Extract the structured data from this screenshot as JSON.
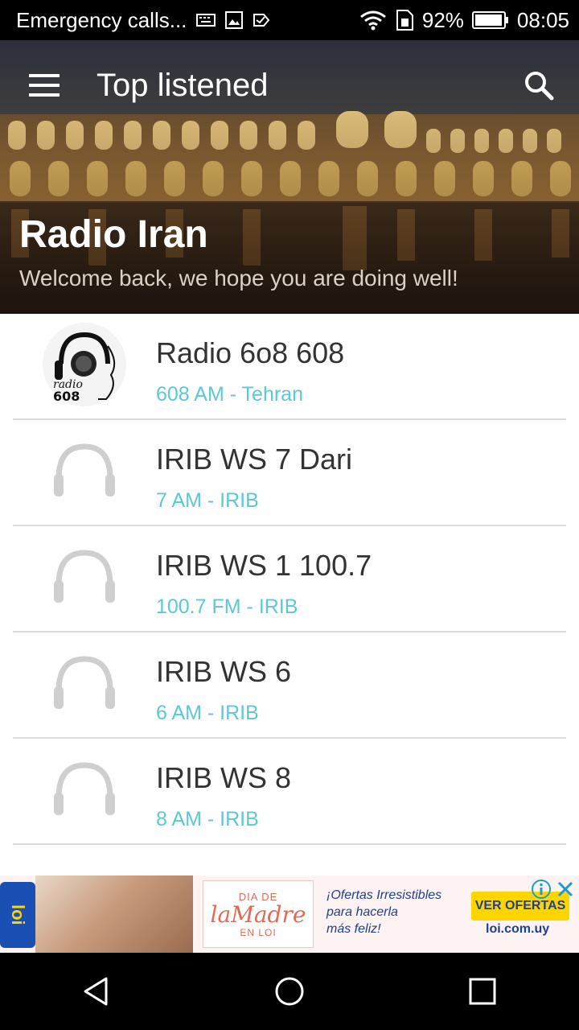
{
  "status_bar": {
    "notification_text": "Emergency calls...",
    "battery_percent": "92%",
    "time": "08:05",
    "icons": [
      "keyboard-icon",
      "image-icon",
      "check-icon",
      "wifi-icon",
      "sim-icon",
      "battery-icon"
    ]
  },
  "header": {
    "toolbar_title": "Top listened",
    "app_title": "Radio Iran",
    "subtitle": "Welcome back, we hope you are doing well!"
  },
  "stations": [
    {
      "name": "Radio 6o8 608",
      "detail": "608 AM - Tehran",
      "logo": "radio-608-logo"
    },
    {
      "name": "IRIB WS 7 Dari",
      "detail": "7 AM - IRIB",
      "logo": "headphones-icon"
    },
    {
      "name": "IRIB WS 1 100.7",
      "detail": "100.7 FM - IRIB",
      "logo": "headphones-icon"
    },
    {
      "name": "IRIB WS 6",
      "detail": "6 AM - IRIB",
      "logo": "headphones-icon"
    },
    {
      "name": "IRIB WS 8",
      "detail": "8 AM - IRIB",
      "logo": "headphones-icon"
    }
  ],
  "ad": {
    "brand": "loi",
    "box_line1": "DIA DE",
    "box_line2": "laMadre",
    "box_line3": "EN LOI",
    "copy_line1": "¡Ofertas Irresistibles",
    "copy_line2": "para hacerla",
    "copy_line3": "más feliz!",
    "cta": "VER OFERTAS",
    "url": "loi.com.uy"
  },
  "colors": {
    "accent_subtext": "#5bc8d6",
    "item_title": "#333333",
    "divider": "#dcdcdc"
  }
}
